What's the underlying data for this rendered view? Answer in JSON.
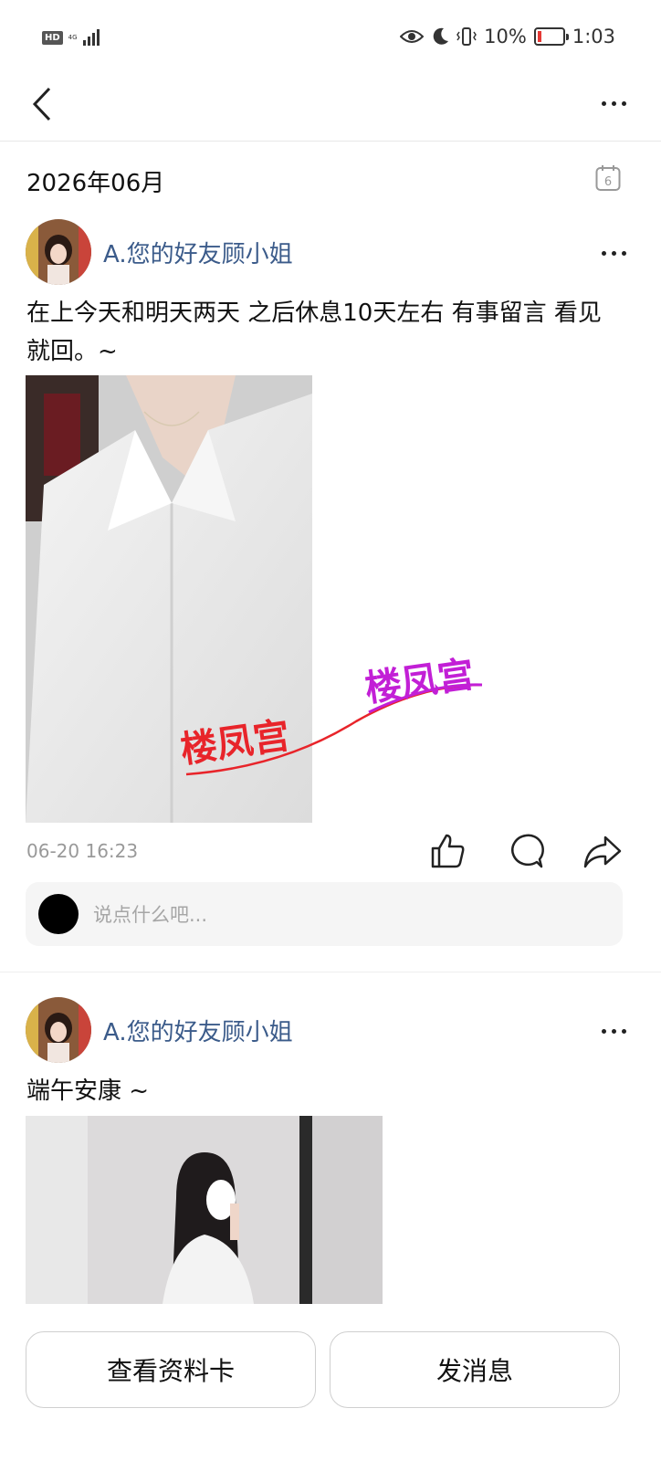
{
  "status_bar": {
    "hd": "HD",
    "network": "4G",
    "battery_percent": "10%",
    "time": "1:03",
    "battery_level": 0.1
  },
  "nav": {
    "back_icon": "chevron-left-icon",
    "more_icon": "more-horizontal-icon"
  },
  "feed": {
    "month_header": "2026年06月",
    "calendar_day": "6",
    "posts": [
      {
        "author": "A.您的好友顾小姐",
        "text": " 在上今天和明天两天 之后休息10天左右  有事留言 看见就回。~",
        "watermark_1": "楼凤宫",
        "watermark_2": "楼凤宫",
        "time": "06-20 16:23",
        "comment_placeholder": "说点什么吧..."
      },
      {
        "author": "A.您的好友顾小姐",
        "text": "  端午安康 ~"
      }
    ]
  },
  "bottom_bar": {
    "profile_card_label": "查看资料卡",
    "send_message_label": "发消息"
  },
  "colors": {
    "name": "#3b5b8a",
    "watermark_red": "#e8242a",
    "watermark_purple": "#c21fd6"
  }
}
